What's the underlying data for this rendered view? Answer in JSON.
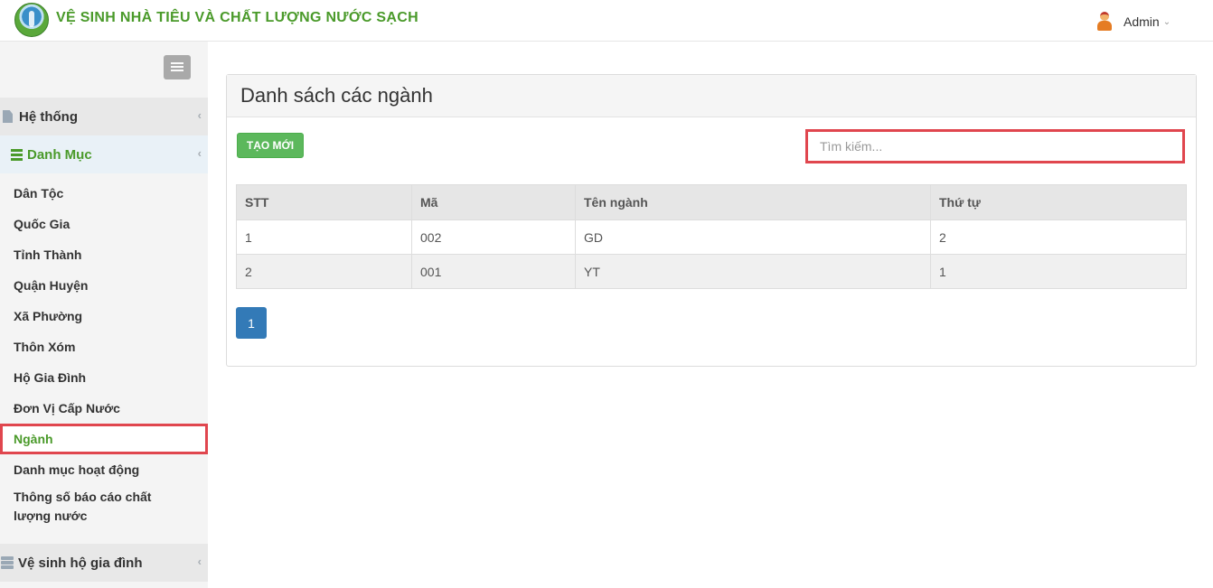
{
  "header": {
    "app_title": "VỆ SINH NHÀ TIÊU VÀ CHẤT LƯỢNG NƯỚC SẠCH",
    "user_name": "Admin"
  },
  "sidebar": {
    "groups": [
      {
        "label": "Hệ thống",
        "icon": "document-icon",
        "expanded": false
      },
      {
        "label": "Danh Mục",
        "icon": "list-icon",
        "expanded": true
      },
      {
        "label": "Vệ sinh hộ gia đình",
        "icon": "server-icon",
        "expanded": false
      }
    ],
    "items": [
      {
        "label": "Dân Tộc"
      },
      {
        "label": "Quốc Gia"
      },
      {
        "label": "Tỉnh Thành"
      },
      {
        "label": "Quận Huyện"
      },
      {
        "label": "Xã Phường"
      },
      {
        "label": "Thôn Xóm"
      },
      {
        "label": "Hộ Gia Đình"
      },
      {
        "label": "Đơn Vị Cấp Nước"
      },
      {
        "label": "Ngành",
        "active": true
      },
      {
        "label": "Danh mục hoạt động"
      },
      {
        "label": "Thông số báo cáo chất lượng nước"
      }
    ]
  },
  "main": {
    "title": "Danh sách các ngành",
    "create_button": "TẠO MỚI",
    "search_placeholder": "Tìm kiếm...",
    "table": {
      "headers": [
        "STT",
        "Mã",
        "Tên ngành",
        "Thứ tự"
      ],
      "rows": [
        [
          "1",
          "002",
          "GD",
          "2"
        ],
        [
          "2",
          "001",
          "YT",
          "1"
        ]
      ]
    },
    "pagination": {
      "current_page": "1"
    }
  },
  "colors": {
    "accent_green": "#4a9a2a",
    "button_green": "#5cb85c",
    "primary_blue": "#337ab7",
    "highlight_red": "#e0464e"
  }
}
